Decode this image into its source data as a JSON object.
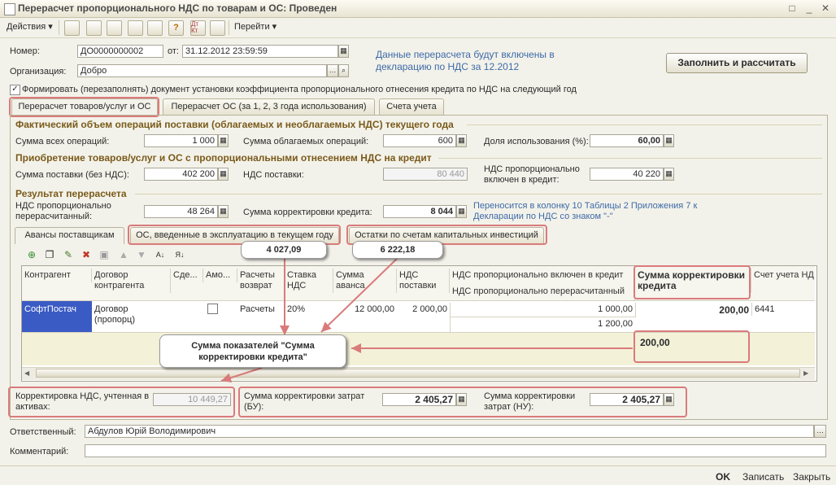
{
  "window": {
    "title": "Перерасчет пропорционального НДС по товарам и ОС: Проведен"
  },
  "toolbar": {
    "actions": "Действия",
    "goto": "Перейти"
  },
  "header": {
    "number_label": "Номер:",
    "number_value": "ДО0000000002",
    "date_label": "от:",
    "date_value": "31.12.2012 23:59:59",
    "org_label": "Организация:",
    "org_value": "Добро",
    "info": "Данные перерасчета будут включены в декларацию по НДС за 12.2012",
    "fill_button": "Заполнить и рассчитать",
    "checkbox_label": "Формировать (перезаполнять) документ установки коэффициента пропорционального отнесения кредита по НДС на следующий год"
  },
  "tabs": [
    "Перерасчет товаров/услуг и ОС",
    "Перерасчет ОС (за 1, 2, 3 года использования)",
    "Счета учета"
  ],
  "section1": {
    "title": "Фактический объем операций поставки (облагаемых и необлагаемых НДС) текущего года",
    "total_label": "Сумма всех операций:",
    "total_value": "1 000",
    "taxed_label": "Сумма облагаемых операций:",
    "taxed_value": "600",
    "share_label": "Доля использования (%):",
    "share_value": "60,00"
  },
  "section2": {
    "title": "Приобретение товаров/услуг и ОС с пропорциональными отнесением НДС на кредит",
    "supply_label": "Сумма поставки (без НДС):",
    "supply_value": "402 200",
    "vat_label": "НДС поставки:",
    "vat_value": "80 440",
    "prop_label": "НДС пропорционально включен в кредит:",
    "prop_value": "40 220"
  },
  "section3": {
    "title": "Результат перерасчета",
    "recalc_label": "НДС пропорционально перерасчитанный:",
    "recalc_value": "48 264",
    "corr_label": "Сумма корректировки кредита:",
    "corr_value": "8 044",
    "note": "Переносится в колонку 10 Таблицы 2 Приложения 7 к Декларации по НДС со знаком \"-\""
  },
  "subtabs": [
    "Авансы поставщикам",
    "ОС, введенные в эксплуатацию в текущем году",
    "Остатки по счетам капитальных инвестиций"
  ],
  "grid": {
    "columns": [
      "Контрагент",
      "Договор контрагента",
      "Сде...",
      "Амо...",
      "Расчеты возврат",
      "Ставка НДС",
      "Сумма аванса",
      "НДС поставки",
      "НДС пропорционально включен в кредит",
      "НДС пропорционально перерасчитанный",
      "Сумма корректировки кредита",
      "Счет учета НД"
    ],
    "row": {
      "counterparty": "СофтПостач",
      "contract": "Договор (пропорц)",
      "settlements": "Расчеты",
      "rate": "20%",
      "advance": "12 000,00",
      "vat": "2 000,00",
      "prop_included": "1 000,00",
      "prop_recalc": "1 200,00",
      "corr": "200,00",
      "account": "6441"
    },
    "total_corr": "200,00"
  },
  "callouts": {
    "c1": "4 027,09",
    "c2": "6 222,18",
    "c3": "Сумма показателей \"Сумма корректировки кредита\""
  },
  "bottom": {
    "vat_assets_label": "Корректировка НДС, учтенная в активах:",
    "vat_assets_value": "10 449,27",
    "cost_bu_label": "Сумма корректировки затрат (БУ):",
    "cost_bu_value": "2 405,27",
    "cost_nu_label": "Сумма корректировки затрат (НУ):",
    "cost_nu_value": "2 405,27",
    "resp_label": "Ответственный:",
    "resp_value": "Абдулов Юрій Володимирович",
    "comment_label": "Комментарий:",
    "comment_value": ""
  },
  "footer": {
    "ok": "OK",
    "save": "Записать",
    "close": "Закрыть"
  }
}
